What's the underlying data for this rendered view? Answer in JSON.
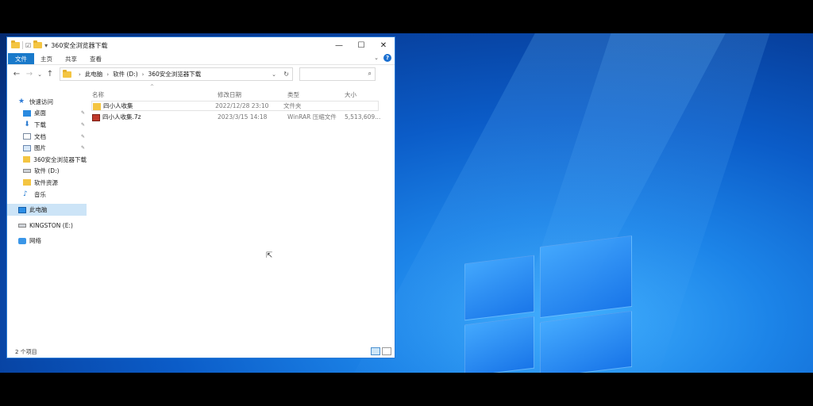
{
  "window": {
    "title": "360安全浏览器下载",
    "controls": {
      "minimize": "—",
      "maximize": "☐",
      "close": "✕"
    }
  },
  "ribbon": {
    "tabs": [
      "文件",
      "主页",
      "共享",
      "查看"
    ]
  },
  "address": {
    "crumbs": [
      "此电脑",
      "软件 (D:)",
      "360安全浏览器下载"
    ],
    "search_placeholder": ""
  },
  "sidebar": {
    "quick_access_label": "快速访问",
    "items": [
      {
        "label": "桌面",
        "icon": "desktop-icon",
        "pinned": true
      },
      {
        "label": "下载",
        "icon": "download-icon",
        "pinned": true
      },
      {
        "label": "文档",
        "icon": "document-icon",
        "pinned": true
      },
      {
        "label": "图片",
        "icon": "pictures-icon",
        "pinned": true
      },
      {
        "label": "360安全浏览器下载",
        "icon": "folder-icon",
        "pinned": false
      },
      {
        "label": "软件 (D:)",
        "icon": "drive-icon",
        "pinned": false
      },
      {
        "label": "软件资源",
        "icon": "folder-icon",
        "pinned": false
      },
      {
        "label": "音乐",
        "icon": "music-icon",
        "pinned": false
      }
    ],
    "this_pc": "此电脑",
    "kingston": "KINGSTON (E:)",
    "network": "网络"
  },
  "columns": {
    "name": "名称",
    "date": "修改日期",
    "type": "类型",
    "size": "大小"
  },
  "files": [
    {
      "name": "四小人收集",
      "date": "2022/12/28 23:10",
      "type": "文件夹",
      "size": "",
      "icon": "folder-icon"
    },
    {
      "name": "四小人收集.7z",
      "date": "2023/3/15 14:18",
      "type": "WinRAR 压缩文件",
      "size": "5,513,609...",
      "icon": "archive-icon"
    }
  ],
  "status": {
    "count": "2 个项目"
  },
  "colors": {
    "accent": "#1979ca",
    "selection": "#cce4f7",
    "desktop": "#0b5cc8"
  }
}
